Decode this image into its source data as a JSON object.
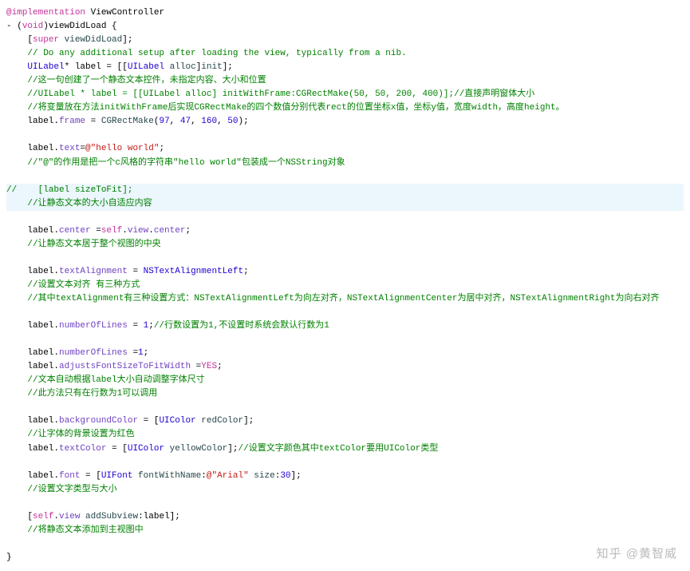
{
  "code": {
    "l1": [
      {
        "t": "@implementation",
        "c": "kw-magenta"
      },
      {
        "t": " ViewController",
        "c": "ident"
      }
    ],
    "l2": [
      {
        "t": "- (",
        "c": "ident"
      },
      {
        "t": "void",
        "c": "kw-magenta"
      },
      {
        "t": ")viewDidLoad {",
        "c": "ident"
      }
    ],
    "l3": [
      {
        "t": "    [",
        "c": "ident"
      },
      {
        "t": "super",
        "c": "kw-magenta"
      },
      {
        "t": " ",
        "c": "ident"
      },
      {
        "t": "viewDidLoad",
        "c": "method"
      },
      {
        "t": "];",
        "c": "ident"
      }
    ],
    "l4": [
      {
        "t": "    // Do any additional setup after loading the view, typically from a nib.",
        "c": "comment"
      }
    ],
    "l5": [
      {
        "t": "    ",
        "c": "ident"
      },
      {
        "t": "UILabel",
        "c": "type"
      },
      {
        "t": "* label = [[",
        "c": "ident"
      },
      {
        "t": "UILabel",
        "c": "type"
      },
      {
        "t": " ",
        "c": "ident"
      },
      {
        "t": "alloc",
        "c": "method"
      },
      {
        "t": "]",
        "c": "ident"
      },
      {
        "t": "init",
        "c": "method"
      },
      {
        "t": "];",
        "c": "ident"
      }
    ],
    "l6": [
      {
        "t": "    //这一句创建了一个静态文本控件，未指定内容、大小和位置",
        "c": "comment"
      }
    ],
    "l7": [
      {
        "t": "    //UILabel * label = [[UILabel alloc] initWithFrame:CGRectMake(50, 50, 200, 400)];//直接声明窗体大小",
        "c": "comment"
      }
    ],
    "l8": [
      {
        "t": "    //将变量放在方法initWithFrame后实现CGRectMake的四个数值分别代表rect的位置坐标x值，坐标y值，宽度width，高度height。",
        "c": "comment"
      }
    ],
    "l9": [
      {
        "t": "    label.",
        "c": "ident"
      },
      {
        "t": "frame",
        "c": "prop"
      },
      {
        "t": " = ",
        "c": "ident"
      },
      {
        "t": "CGRectMake",
        "c": "method"
      },
      {
        "t": "(",
        "c": "ident"
      },
      {
        "t": "97",
        "c": "num"
      },
      {
        "t": ", ",
        "c": "ident"
      },
      {
        "t": "47",
        "c": "num"
      },
      {
        "t": ", ",
        "c": "ident"
      },
      {
        "t": "160",
        "c": "num"
      },
      {
        "t": ", ",
        "c": "ident"
      },
      {
        "t": "50",
        "c": "num"
      },
      {
        "t": ");",
        "c": "ident"
      }
    ],
    "l10": [
      {
        "t": "    ",
        "c": "ident"
      }
    ],
    "l11": [
      {
        "t": "    label.",
        "c": "ident"
      },
      {
        "t": "text",
        "c": "prop"
      },
      {
        "t": "=",
        "c": "ident"
      },
      {
        "t": "@\"hello world\"",
        "c": "str"
      },
      {
        "t": ";",
        "c": "ident"
      }
    ],
    "l12": [
      {
        "t": "    //\"@\"的作用是把一个c风格的字符串\"hello world\"包装成一个NSString对象",
        "c": "comment"
      }
    ],
    "l13": [
      {
        "t": "    ",
        "c": "ident"
      }
    ],
    "l14": [
      {
        "t": "//    [label sizeToFit];",
        "c": "comment"
      }
    ],
    "l15": [
      {
        "t": "    //让静态文本的大小自适应内容",
        "c": "comment"
      }
    ],
    "l16": [
      {
        "t": "    ",
        "c": "ident"
      }
    ],
    "l17": [
      {
        "t": "    label.",
        "c": "ident"
      },
      {
        "t": "center",
        "c": "prop"
      },
      {
        "t": " =",
        "c": "ident"
      },
      {
        "t": "self",
        "c": "kw-magenta"
      },
      {
        "t": ".",
        "c": "ident"
      },
      {
        "t": "view",
        "c": "prop"
      },
      {
        "t": ".",
        "c": "ident"
      },
      {
        "t": "center",
        "c": "prop"
      },
      {
        "t": ";",
        "c": "ident"
      }
    ],
    "l18": [
      {
        "t": "    //让静态文本居于整个视图的中央",
        "c": "comment"
      }
    ],
    "l19": [
      {
        "t": "    ",
        "c": "ident"
      }
    ],
    "l20": [
      {
        "t": "    label.",
        "c": "ident"
      },
      {
        "t": "textAlignment",
        "c": "prop"
      },
      {
        "t": " = ",
        "c": "ident"
      },
      {
        "t": "NSTextAlignmentLeft",
        "c": "type"
      },
      {
        "t": ";",
        "c": "ident"
      }
    ],
    "l21": [
      {
        "t": "    //设置文本对齐 有三种方式",
        "c": "comment"
      }
    ],
    "l22": [
      {
        "t": "    //其中textAlignment有三种设置方式：NSTextAlignmentLeft为向左对齐，NSTextAlignmentCenter为居中对齐，NSTextAlignmentRight为向右对齐",
        "c": "comment"
      }
    ],
    "l23": [
      {
        "t": "    ",
        "c": "ident"
      }
    ],
    "l24": [
      {
        "t": "    label.",
        "c": "ident"
      },
      {
        "t": "numberOfLines",
        "c": "prop"
      },
      {
        "t": " = ",
        "c": "ident"
      },
      {
        "t": "1",
        "c": "num"
      },
      {
        "t": ";",
        "c": "ident"
      },
      {
        "t": "//行数设置为1,不设置时系统会默认行数为1",
        "c": "comment"
      }
    ],
    "l25": [
      {
        "t": "    ",
        "c": "ident"
      }
    ],
    "l26": [
      {
        "t": "    label.",
        "c": "ident"
      },
      {
        "t": "numberOfLines",
        "c": "prop"
      },
      {
        "t": " =",
        "c": "ident"
      },
      {
        "t": "1",
        "c": "num"
      },
      {
        "t": ";",
        "c": "ident"
      }
    ],
    "l27": [
      {
        "t": "    label.",
        "c": "ident"
      },
      {
        "t": "adjustsFontSizeToFitWidth",
        "c": "prop"
      },
      {
        "t": " =",
        "c": "ident"
      },
      {
        "t": "YES",
        "c": "kw-magenta"
      },
      {
        "t": ";",
        "c": "ident"
      }
    ],
    "l28": [
      {
        "t": "    //文本自动根据label大小自动调整字体尺寸",
        "c": "comment"
      }
    ],
    "l29": [
      {
        "t": "    //此方法只有在行数为1可以调用",
        "c": "comment"
      }
    ],
    "l30": [
      {
        "t": "    ",
        "c": "ident"
      }
    ],
    "l31": [
      {
        "t": "    label.",
        "c": "ident"
      },
      {
        "t": "backgroundColor",
        "c": "prop"
      },
      {
        "t": " = [",
        "c": "ident"
      },
      {
        "t": "UIColor",
        "c": "type"
      },
      {
        "t": " ",
        "c": "ident"
      },
      {
        "t": "redColor",
        "c": "method"
      },
      {
        "t": "];",
        "c": "ident"
      }
    ],
    "l32": [
      {
        "t": "    //让字体的背景设置为红色",
        "c": "comment"
      }
    ],
    "l33": [
      {
        "t": "    label.",
        "c": "ident"
      },
      {
        "t": "textColor",
        "c": "prop"
      },
      {
        "t": " = [",
        "c": "ident"
      },
      {
        "t": "UIColor",
        "c": "type"
      },
      {
        "t": " ",
        "c": "ident"
      },
      {
        "t": "yellowColor",
        "c": "method"
      },
      {
        "t": "];",
        "c": "ident"
      },
      {
        "t": "//设置文字颜色其中textColor要用UIColor类型",
        "c": "comment"
      }
    ],
    "l34": [
      {
        "t": "    ",
        "c": "ident"
      }
    ],
    "l35": [
      {
        "t": "    label.",
        "c": "ident"
      },
      {
        "t": "font",
        "c": "prop"
      },
      {
        "t": " = [",
        "c": "ident"
      },
      {
        "t": "UIFont",
        "c": "type"
      },
      {
        "t": " ",
        "c": "ident"
      },
      {
        "t": "fontWithName",
        "c": "method"
      },
      {
        "t": ":",
        "c": "ident"
      },
      {
        "t": "@\"Arial\"",
        "c": "str"
      },
      {
        "t": " ",
        "c": "ident"
      },
      {
        "t": "size",
        "c": "method"
      },
      {
        "t": ":",
        "c": "ident"
      },
      {
        "t": "30",
        "c": "num"
      },
      {
        "t": "];",
        "c": "ident"
      }
    ],
    "l36": [
      {
        "t": "    //设置文字类型与大小",
        "c": "comment"
      }
    ],
    "l37": [
      {
        "t": "    ",
        "c": "ident"
      }
    ],
    "l38": [
      {
        "t": "    [",
        "c": "ident"
      },
      {
        "t": "self",
        "c": "kw-magenta"
      },
      {
        "t": ".",
        "c": "ident"
      },
      {
        "t": "view",
        "c": "prop"
      },
      {
        "t": " ",
        "c": "ident"
      },
      {
        "t": "addSubview",
        "c": "method"
      },
      {
        "t": ":label];",
        "c": "ident"
      }
    ],
    "l39": [
      {
        "t": "    //将静态文本添加到主视图中",
        "c": "comment"
      }
    ],
    "l40": [
      {
        "t": "    ",
        "c": "ident"
      }
    ],
    "l41": [
      {
        "t": "}",
        "c": "ident"
      }
    ]
  },
  "highlight_lines": [
    "l14",
    "l15"
  ],
  "watermark": "知乎 @黄智威"
}
